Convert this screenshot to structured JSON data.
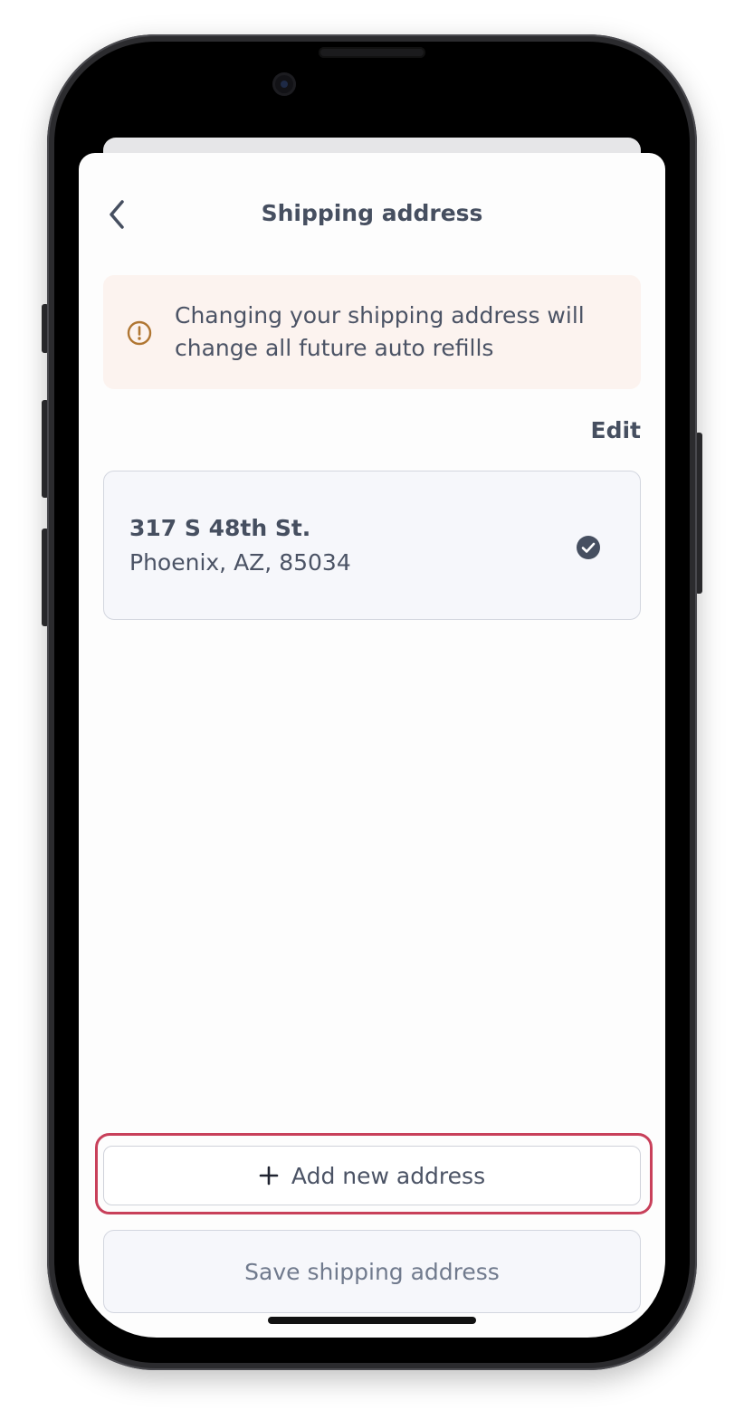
{
  "header": {
    "title": "Shipping address",
    "back_icon": "chevron-left-icon"
  },
  "notice": {
    "icon": "exclamation-circle-icon",
    "text": "Changing your shipping address will change all future auto refills",
    "background_color": "#fcf3ef",
    "icon_color": "#b07632"
  },
  "edit_label": "Edit",
  "address": {
    "line1": "317 S 48th St.",
    "line2": "Phoenix, AZ, 85034",
    "selected": true,
    "check_icon": "check-circle-icon"
  },
  "actions": {
    "add_label": "Add new address",
    "add_icon": "plus-icon",
    "save_label": "Save shipping address",
    "highlight_color": "#c8405a"
  }
}
